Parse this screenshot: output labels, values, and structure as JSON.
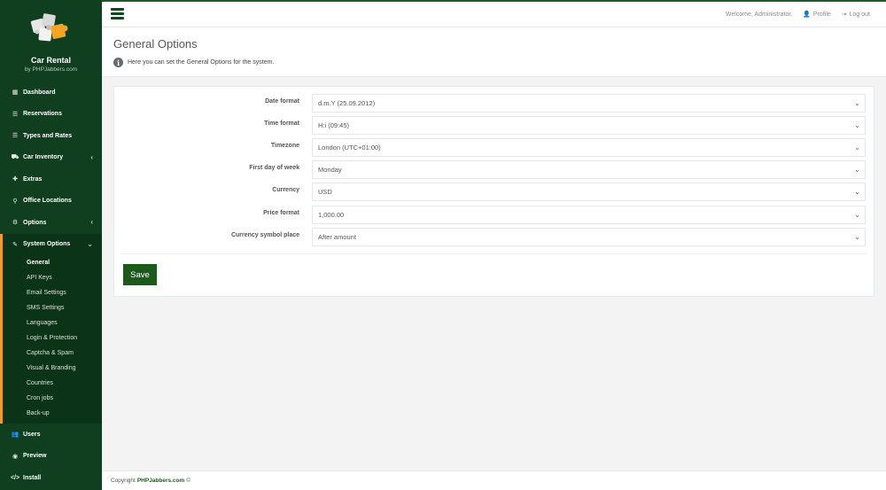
{
  "brand": {
    "title": "Car Rental",
    "subtitle": "by PHPJabbers.com"
  },
  "nav": {
    "dashboard": "Dashboard",
    "reservations": "Reservations",
    "types_rates": "Types and Rates",
    "car_inventory": "Car Inventory",
    "extras": "Extras",
    "office_locations": "Office Locations",
    "options": "Options",
    "system_options": "System Options",
    "users": "Users",
    "preview": "Preview",
    "install": "Install"
  },
  "subnav": [
    "General",
    "API Keys",
    "Email Settings",
    "SMS Settings",
    "Languages",
    "Login & Protection",
    "Captcha & Spam",
    "Visual & Branding",
    "Countries",
    "Cron jobs",
    "Back-up"
  ],
  "topbar": {
    "welcome": "Welcome, Administrator.",
    "profile": "Profile",
    "logout": "Log out"
  },
  "page": {
    "title": "General Options",
    "info": "Here you can set the General Options for the system."
  },
  "form": [
    {
      "label": "Date format",
      "value": "d.m.Y (25.09.2012)"
    },
    {
      "label": "Time format",
      "value": "H:i (09:45)"
    },
    {
      "label": "Timezone",
      "value": "London (UTC+01:00)"
    },
    {
      "label": "First day of week",
      "value": "Monday"
    },
    {
      "label": "Currency",
      "value": "USD"
    },
    {
      "label": "Price format",
      "value": "1,000.00"
    },
    {
      "label": "Currency symbol place",
      "value": "After amount"
    }
  ],
  "save_label": "Save",
  "footer": {
    "copyright": "Copyright",
    "brand": "PHPJabbers.com",
    "symbol": "©"
  },
  "colors": {
    "sidebar": "#0f3f1e",
    "accent": "#f59b1e",
    "primary_button": "#1c5a1c"
  }
}
